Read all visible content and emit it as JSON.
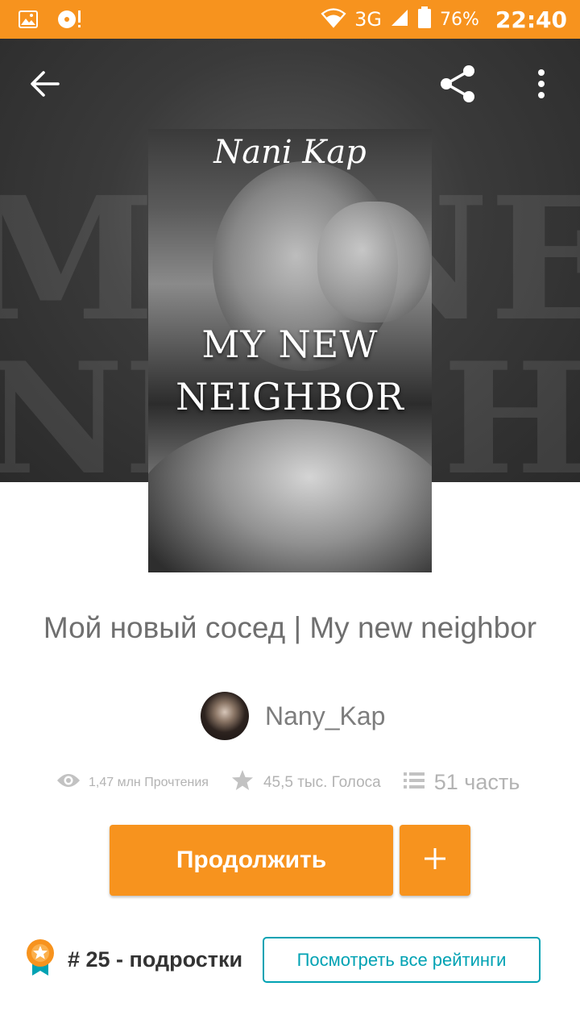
{
  "status_bar": {
    "network": "3G",
    "battery": "76%",
    "time": "22:40",
    "icons": [
      "image-icon",
      "media-icon",
      "wifi-icon",
      "signal-icon",
      "battery-icon"
    ]
  },
  "header": {
    "back_icon": "arrow-left-icon",
    "share_icon": "share-icon",
    "more_icon": "more-vertical-icon"
  },
  "cover": {
    "author": "Nani Kap",
    "title_line1": "MY NEW",
    "title_line2": "NEIGHBOR"
  },
  "book": {
    "title": "Мой новый сосед | My new neighbor",
    "author": "Nany_Kap"
  },
  "stats": {
    "reads": "1,47 млн Прочтения",
    "votes": "45,5 тыс. Голоса",
    "parts": "51 часть"
  },
  "actions": {
    "continue_label": "Продолжить",
    "add_icon": "plus-icon"
  },
  "ranking": {
    "text": "# 25 - подростки",
    "all_ratings_label": "Посмотреть все рейтинги",
    "badge_icon": "ranking-badge-icon"
  },
  "colors": {
    "accent": "#f7931e",
    "link": "#00a2b3"
  }
}
